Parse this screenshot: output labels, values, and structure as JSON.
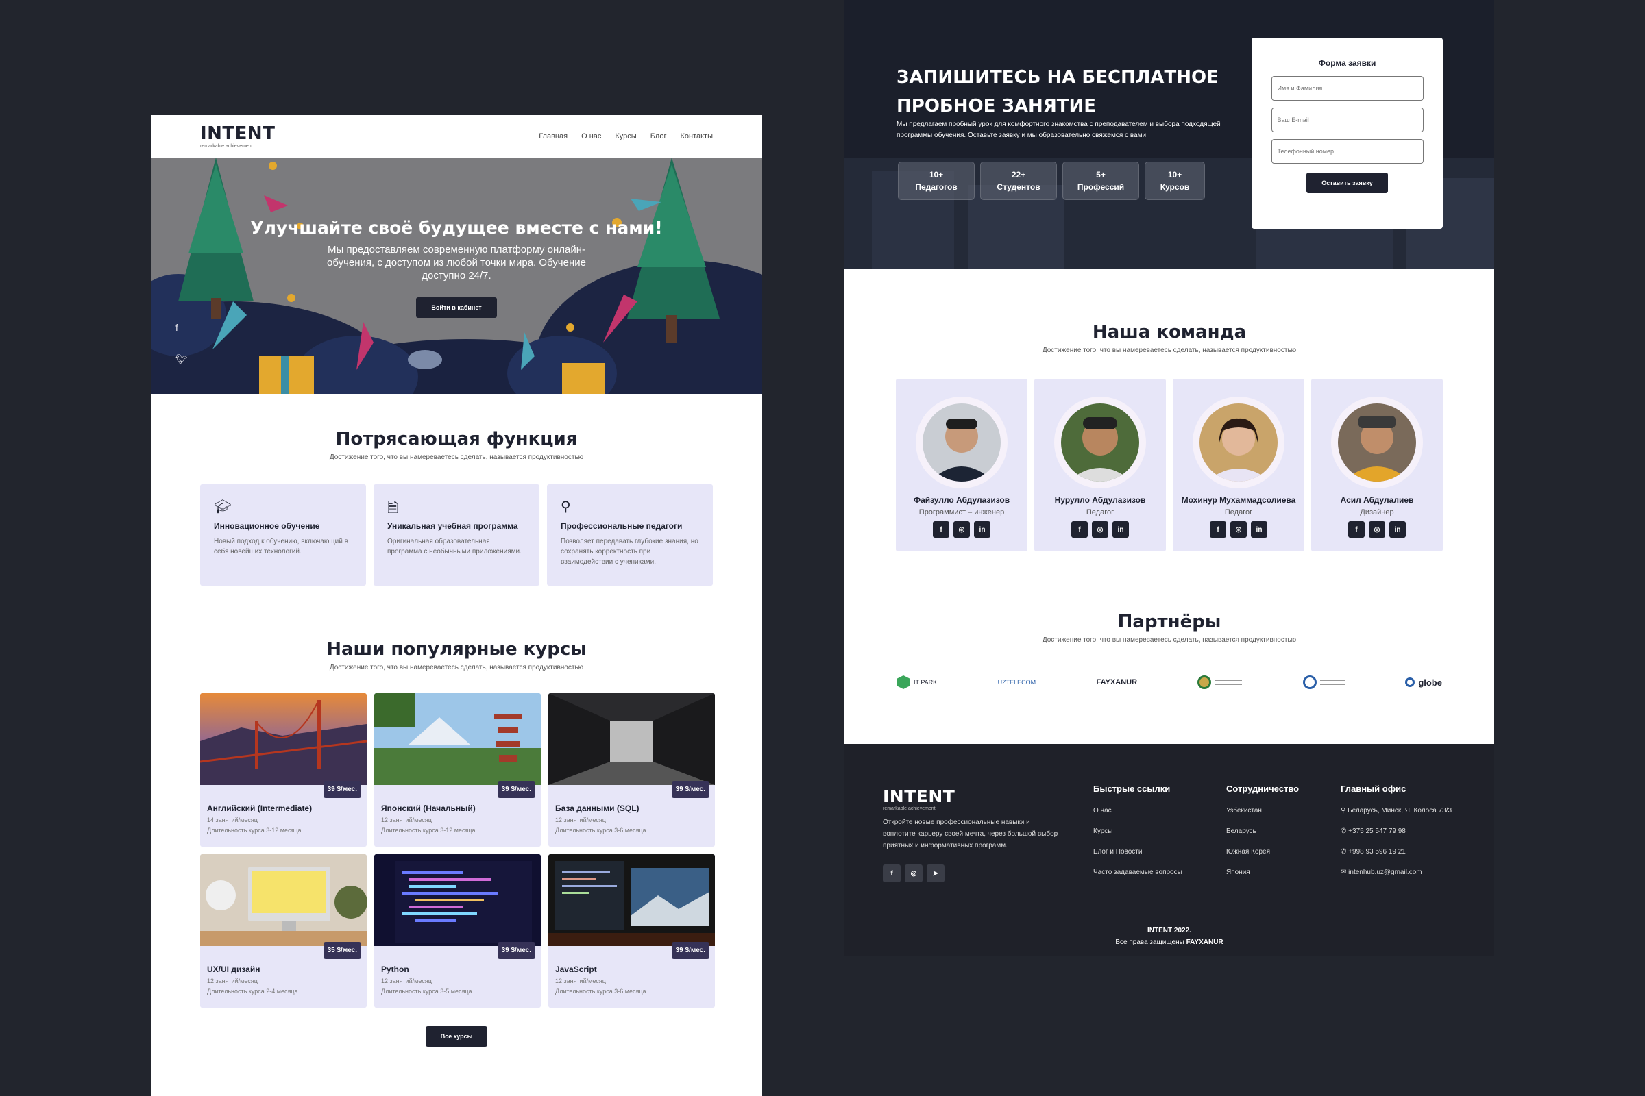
{
  "left": {
    "logo": {
      "name": "INTENT",
      "tagline": "remarkable achievement"
    },
    "nav": [
      "Главная",
      "О нас",
      "Курсы",
      "Блог",
      "Контакты"
    ],
    "hero": {
      "title": "Улучшайте своё будущее вместе с нами!",
      "text": "Мы предоставляем современную платформу онлайн-обучения, с доступом из любой точки мира. Обучение доступно 24/7.",
      "button": "Войти в кабинет"
    },
    "features": {
      "title": "Потрясающая функция",
      "subtitle": "Достижение того, что вы намереваетесь сделать, называется продуктивностью",
      "items": [
        {
          "icon": "graduation-cap-icon",
          "title": "Инновационное обучение",
          "desc": "Новый подход к обучению, включающий в себя новейших технологий."
        },
        {
          "icon": "document-icon",
          "title": "Уникальная учебная программа",
          "desc": "Оригинальная образовательная программа с необычными приложениями."
        },
        {
          "icon": "award-icon",
          "title": "Профессиональные педагоги",
          "desc": "Позволяет передавать глубокие знания, но сохранять корректность при взаимодействии с учениками."
        }
      ]
    },
    "courses": {
      "title": "Наши популярные курсы",
      "subtitle": "Достижение того, что вы намереваетесь сделать, называется продуктивностью",
      "items": [
        {
          "title": "Английский (Intermediate)",
          "meta": "14 занятий/месяц",
          "duration": "Длительность курса 3-12 месяца",
          "price": "39 $/мес."
        },
        {
          "title": "Японский (Начальный)",
          "meta": "12 занятий/месяц",
          "duration": "Длительность курса 3-12 месяца.",
          "price": "39 $/мес."
        },
        {
          "title": "База данными (SQL)",
          "meta": "12 занятий/месяц",
          "duration": "Длительность курса 3-6 месяца.",
          "price": "39 $/мес."
        },
        {
          "title": "UX/UI дизайн",
          "meta": "12 занятий/месяц",
          "duration": "Длительность курса 2-4 месяца.",
          "price": "35 $/мес."
        },
        {
          "title": "Python",
          "meta": "12 занятий/месяц",
          "duration": "Длительность курса 3-5 месяца.",
          "price": "39 $/мес."
        },
        {
          "title": "JavaScript",
          "meta": "12 занятий/месяц",
          "duration": "Длительность курса 3-6 месяца.",
          "price": "39 $/мес."
        }
      ],
      "button": "Все курсы"
    }
  },
  "right": {
    "signup": {
      "title_line1": "ЗАПИШИТЕСЬ НА БЕСПЛАТНОЕ",
      "title_line2": "ПРОБНОЕ ЗАНЯТИЕ",
      "text": "Мы предлагаем пробный урок для комфортного знакомства с преподавателем и выбора подходящей программы обучения. Оставьте заявку и мы образовательно свяжемся с вами!",
      "stats": [
        {
          "value": "10+",
          "label": "Педагогов"
        },
        {
          "value": "22+",
          "label": "Студентов"
        },
        {
          "value": "5+",
          "label": "Профессий"
        },
        {
          "value": "10+",
          "label": "Курсов"
        }
      ],
      "form": {
        "title": "Форма заявки",
        "name_placeholder": "Имя и Фамилия",
        "email_placeholder": "Ваш E-mail",
        "phone_placeholder": "Телефонный номер",
        "button": "Оставить заявку"
      }
    },
    "team": {
      "title": "Наша команда",
      "subtitle": "Достижение того, что вы намереваетесь сделать, называется продуктивностью",
      "members": [
        {
          "name": "Файзулло Абдулазизов",
          "role": "Программист – инженер"
        },
        {
          "name": "Нурулло Абдулазизов",
          "role": "Педагог"
        },
        {
          "name": "Мохинур Мухаммадсолиева",
          "role": "Педагог"
        },
        {
          "name": "Асил Абдулалиев",
          "role": "Дизайнер"
        }
      ]
    },
    "partners": {
      "title": "Партнёры",
      "subtitle": "Достижение того, что вы намереваетесь сделать, называется продуктивностью",
      "items": [
        "IT PARK",
        "UZTELECOM",
        "FAYXANUR",
        "",
        "",
        "globe"
      ]
    },
    "footer": {
      "logo": {
        "name": "INTENT",
        "tagline": "remarkable achievement"
      },
      "desc": "Откройте новые профессиональные навыки и воплотите карьеру своей мечта, через большой выбор приятных и информативных программ.",
      "columns": [
        {
          "title": "Быстрые ссылки",
          "items": [
            "О нас",
            "Курсы",
            "Блог и Новости",
            "Часто задаваемые вопросы"
          ]
        },
        {
          "title": "Сотрудничество",
          "items": [
            "Узбекистан",
            "Беларусь",
            "Южная Корея",
            "Япония"
          ]
        },
        {
          "title": "Главный офис",
          "items": [
            "Беларусь, Минск, Я. Колоса 73/3",
            "+375 25 547 79 98",
            "+998 93 596 19 21",
            "intenhub.uz@gmail.com"
          ]
        }
      ],
      "copyright": "INTENT 2022.",
      "rights_prefix": "Все права защищены",
      "rights_brand": "FAYXANUR"
    }
  }
}
